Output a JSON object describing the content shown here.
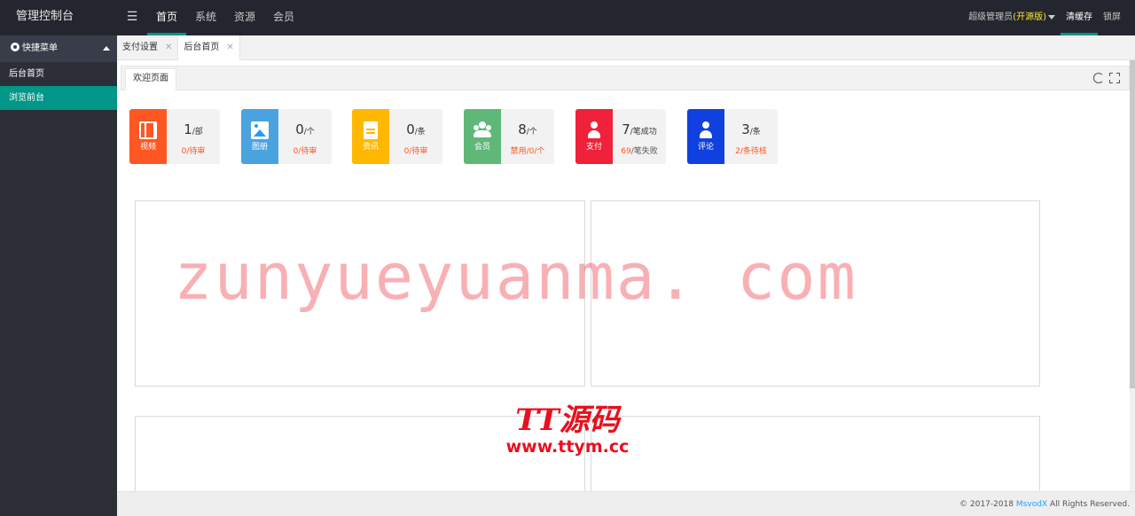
{
  "app": {
    "title": "管理控制台"
  },
  "topnav": {
    "items": [
      "首页",
      "系统",
      "资源",
      "会员"
    ],
    "active_index": 0
  },
  "topright": {
    "user": "超级管理员",
    "edition": "(开源版)",
    "clear_cache": "清缓存",
    "lock": "锁屏"
  },
  "sidebar": {
    "header": "快捷菜单",
    "items": [
      "后台首页",
      "浏览前台"
    ],
    "active_index": 1
  },
  "tabs": {
    "items": [
      "支付设置",
      "后台首页"
    ],
    "active_index": 1
  },
  "inner_tab": "欢迎页面",
  "cards": [
    {
      "label": "视频",
      "value": "1",
      "unit": "/部",
      "sub_value": "0",
      "sub_text": "/待审",
      "color": "#ff5722",
      "icon": "film-icon"
    },
    {
      "label": "图册",
      "value": "0",
      "unit": "/个",
      "sub_value": "0",
      "sub_text": "/待审",
      "color": "#4aa3df",
      "icon": "image-icon"
    },
    {
      "label": "资讯",
      "value": "0",
      "unit": "/条",
      "sub_value": "0",
      "sub_text": "/待审",
      "color": "#ffb800",
      "icon": "document-icon"
    },
    {
      "label": "会员",
      "value": "8",
      "unit": "/个",
      "sub_value": "禁用/0",
      "sub_text": "/个",
      "color": "#5fb878",
      "icon": "users-icon"
    },
    {
      "label": "支付",
      "value": "7",
      "unit": "/笔成功",
      "sub_value": "69",
      "sub_text": "/笔失败",
      "color": "#f0213a",
      "icon": "user-icon"
    },
    {
      "label": "评论",
      "value": "3",
      "unit": "/条",
      "sub_value": "2",
      "sub_text": "/条待核",
      "color": "#1040e0",
      "icon": "user-icon"
    }
  ],
  "footer": {
    "prefix": "© 2017-2018",
    "brand": "MsvodX",
    "suffix": "All Rights Reserved."
  },
  "watermarks": {
    "main": "zunyueyuanma. com",
    "logo": "TT源码",
    "logo_url": "www.ttym.cc"
  },
  "colors": {
    "topbar": "#23262e",
    "sidebar": "#2c2f38",
    "accent": "#009688"
  }
}
